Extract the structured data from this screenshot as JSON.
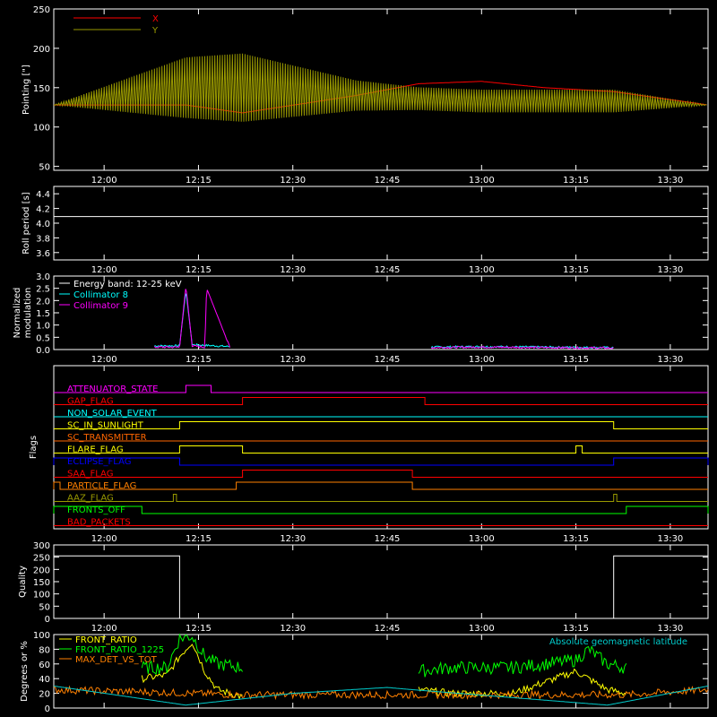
{
  "colors": {
    "background": "#000000",
    "axis": "#ffffff",
    "red": "#ff0000",
    "olive": "#999900",
    "white": "#ffffff",
    "cyan": "#00ffff",
    "magenta": "#ff00ff",
    "yellow": "#ffff00",
    "blue": "#0000ff",
    "orange": "#ff8000",
    "green": "#00ff00",
    "dark_orange": "#ff6600",
    "teal": "#00cccc"
  },
  "time_axis": {
    "ticks": [
      "12:00",
      "12:15",
      "12:30",
      "12:45",
      "13:00",
      "13:15",
      "13:30"
    ]
  },
  "chart_data": [
    {
      "type": "line",
      "id": "pointing",
      "ylabel": "Pointing [\"]",
      "ylim": [
        45,
        250
      ],
      "yticks": [
        "50",
        "100",
        "150",
        "200",
        "250"
      ],
      "xlim": [
        "11:52",
        "13:36"
      ],
      "legend": [
        "X",
        "Y"
      ],
      "legend_placement": "top-left",
      "series": [
        {
          "name": "X",
          "color": "#ff0000",
          "x": [
            "11:52",
            "12:13",
            "12:22",
            "12:40",
            "12:50",
            "13:00",
            "13:10",
            "13:21",
            "13:36"
          ],
          "y_center": [
            128,
            128,
            118,
            140,
            155,
            158,
            150,
            145,
            128
          ],
          "y_amplitude": [
            0,
            30,
            25,
            15,
            12,
            12,
            10,
            10,
            0
          ]
        },
        {
          "name": "Y",
          "color": "#999900",
          "x": [
            "11:52",
            "12:13",
            "12:22",
            "12:40",
            "12:50",
            "13:00",
            "13:10",
            "13:21",
            "13:36"
          ],
          "y_center": [
            128,
            150,
            150,
            140,
            136,
            133,
            133,
            133,
            128
          ],
          "y_amplitude": [
            0,
            40,
            45,
            20,
            15,
            15,
            15,
            15,
            0
          ]
        }
      ]
    },
    {
      "type": "line",
      "id": "roll",
      "ylabel": "Roll period [s]",
      "ylim": [
        3.5,
        4.5
      ],
      "yticks": [
        "3.6",
        "3.8",
        "4.0",
        "4.2",
        "4.4"
      ],
      "series": [
        {
          "color": "#ffffff",
          "x": [
            "11:52",
            "13:36"
          ],
          "y": [
            4.09,
            4.09
          ]
        }
      ]
    },
    {
      "type": "line",
      "id": "modulation",
      "ylabel": "Normalized modulation",
      "ylim": [
        0,
        3.0
      ],
      "yticks": [
        "0.0",
        "0.5",
        "1.0",
        "1.5",
        "2.0",
        "2.5",
        "3.0"
      ],
      "annotations": [
        "Energy band: 12-25 keV",
        "Collimator 8",
        "Collimator 9"
      ],
      "series": [
        {
          "name": "Collimator 8",
          "color": "#00ffff",
          "segments": [
            {
              "x": [
                "12:08",
                "12:12",
                "12:13",
                "12:14",
                "12:20"
              ],
              "y": [
                0.15,
                0.15,
                2.4,
                0.2,
                0.12
              ]
            },
            {
              "x": [
                "12:52",
                "13:00",
                "13:21"
              ],
              "y": [
                0.1,
                0.12,
                0.08
              ]
            }
          ]
        },
        {
          "name": "Collimator 9",
          "color": "#ff00ff",
          "segments": [
            {
              "x": [
                "12:08",
                "12:12",
                "12:13",
                "12:14",
                "12:16",
                "12:16.3",
                "12:20"
              ],
              "y": [
                0.1,
                0.1,
                2.6,
                0.15,
                0.1,
                2.5,
                0.08
              ]
            },
            {
              "x": [
                "12:52",
                "13:00",
                "13:21"
              ],
              "y": [
                0.08,
                0.1,
                0.06
              ]
            }
          ]
        }
      ]
    },
    {
      "type": "step",
      "id": "flags",
      "ylabel": "Flags",
      "flags": [
        {
          "name": "ATTENUATOR_STATE",
          "color": "#ff00ff",
          "high": [
            [
              "12:13",
              "12:17"
            ]
          ]
        },
        {
          "name": "GAP_FLAG",
          "color": "#ff0000",
          "high": [
            [
              "12:22",
              "12:51"
            ]
          ]
        },
        {
          "name": "NON_SOLAR_EVENT",
          "color": "#00ffff",
          "high": []
        },
        {
          "name": "SC_IN_SUNLIGHT",
          "color": "#ffff00",
          "high": [
            [
              "12:12",
              "13:21"
            ]
          ]
        },
        {
          "name": "SC_TRANSMITTER",
          "color": "#ff6600",
          "high": []
        },
        {
          "name": "FLARE_FLAG",
          "color": "#ffff00",
          "high": [
            [
              "12:12",
              "12:22"
            ],
            [
              "13:15",
              "13:16"
            ]
          ]
        },
        {
          "name": "ECLIPSE_FLAG",
          "color": "#0000ff",
          "high": [
            [
              "11:52",
              "12:12"
            ],
            [
              "13:21",
              "13:36"
            ]
          ]
        },
        {
          "name": "SAA_FLAG",
          "color": "#ff0000",
          "high": [
            [
              "12:22",
              "12:49"
            ]
          ]
        },
        {
          "name": "PARTICLE_FLAG",
          "color": "#ff8000",
          "high": [
            [
              "11:52",
              "11:53"
            ],
            [
              "12:21",
              "12:49"
            ]
          ]
        },
        {
          "name": "AAZ_FLAG",
          "color": "#999900",
          "high": [
            [
              "12:11",
              "12:11.5"
            ],
            [
              "13:21",
              "13:21.5"
            ]
          ]
        },
        {
          "name": "FRONTS_OFF",
          "color": "#00ff00",
          "high": [
            [
              "11:52",
              "12:06"
            ],
            [
              "13:23",
              "13:36"
            ]
          ]
        },
        {
          "name": "BAD_PACKETS",
          "color": "#ff0000",
          "high": []
        }
      ]
    },
    {
      "type": "line",
      "id": "quality",
      "ylabel": "Quality",
      "ylim": [
        0,
        300
      ],
      "yticks": [
        "0",
        "50",
        "100",
        "150",
        "200",
        "250",
        "300"
      ],
      "series": [
        {
          "color": "#ffffff",
          "x": [
            "11:52",
            "12:12",
            "12:12",
            "13:21",
            "13:21",
            "13:36"
          ],
          "y": [
            255,
            255,
            0,
            0,
            255,
            255
          ]
        }
      ]
    },
    {
      "type": "line",
      "id": "ratios",
      "ylabel": "Degrees or %",
      "ylim": [
        0,
        100
      ],
      "yticks": [
        "0",
        "20",
        "40",
        "60",
        "80",
        "100"
      ],
      "legend": [
        "FRONT_RATIO",
        "FRONT_RATIO_1225",
        "MAX_DET_VS_TOT",
        "Absolute geomagnetic latitude"
      ],
      "series": [
        {
          "name": "FRONT_RATIO",
          "color": "#ffff00",
          "segments": [
            {
              "x": [
                "12:06",
                "12:10",
                "12:12",
                "12:14",
                "12:16",
                "12:18",
                "12:22"
              ],
              "y": [
                40,
                45,
                70,
                90,
                50,
                25,
                15
              ]
            },
            {
              "x": [
                "12:50",
                "12:55",
                "13:05",
                "13:15",
                "13:20",
                "13:23"
              ],
              "y": [
                25,
                20,
                20,
                50,
                25,
                20
              ]
            }
          ]
        },
        {
          "name": "FRONT_RATIO_1225",
          "color": "#00ff00",
          "segments": [
            {
              "x": [
                "12:06",
                "12:10",
                "12:12",
                "12:14",
                "12:16",
                "12:18",
                "12:22"
              ],
              "y": [
                55,
                55,
                95,
                98,
                70,
                60,
                55
              ]
            },
            {
              "x": [
                "12:50",
                "12:55",
                "13:05",
                "13:15",
                "13:17",
                "13:20",
                "13:23"
              ],
              "y": [
                50,
                55,
                55,
                65,
                80,
                60,
                55
              ]
            }
          ]
        },
        {
          "name": "MAX_DET_VS_TOT",
          "color": "#ff8000",
          "x": [
            "11:52",
            "12:06",
            "12:22",
            "12:50",
            "13:23",
            "13:36"
          ],
          "y": [
            25,
            22,
            18,
            18,
            18,
            25
          ]
        },
        {
          "name": "Absolute geomagnetic latitude",
          "color": "#00cccc",
          "x": [
            "11:52",
            "12:13",
            "12:30",
            "12:45",
            "12:49",
            "13:20",
            "13:36"
          ],
          "y": [
            30,
            4,
            20,
            28,
            25,
            4,
            30
          ]
        }
      ]
    }
  ]
}
